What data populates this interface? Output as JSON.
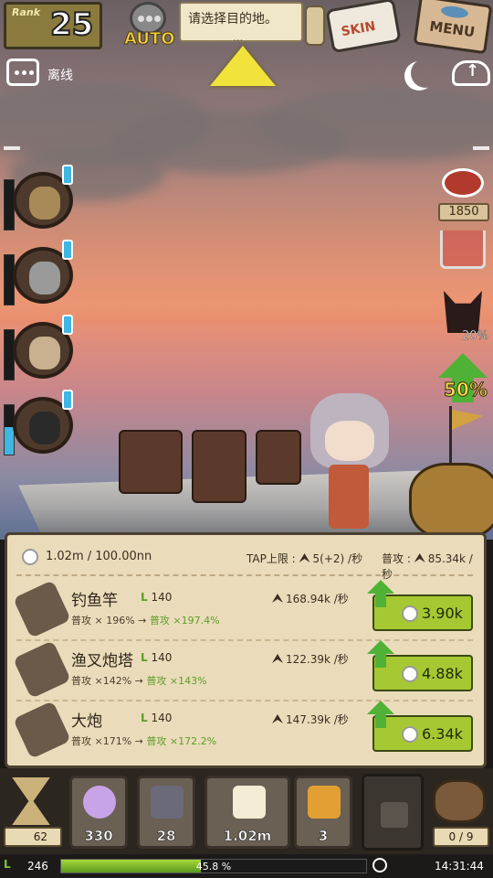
{
  "top": {
    "rank_label": "Rank",
    "rank_value": "25",
    "auto_label": "AUTO",
    "destination_text": "请选择目的地。",
    "destination_dots": "...",
    "skin_label": "SKIN",
    "menu_label": "MENU"
  },
  "status": {
    "chat_status": "离线"
  },
  "side": {
    "meat_count": "1850",
    "demon_percent": "20%",
    "boost_label": "50%"
  },
  "heroes": [
    {
      "name": "hero-1",
      "hp": 0.0,
      "color": "#a88a58"
    },
    {
      "name": "hero-2",
      "hp": 0.0,
      "color": "#9a9a9a"
    },
    {
      "name": "hero-3",
      "hp": 0.0,
      "color": "#c8b090"
    },
    {
      "name": "hero-4",
      "hp": 0.55,
      "color": "#2a2a2a"
    }
  ],
  "panel": {
    "resource": "1.02m / 100.00nn",
    "resource_main": "1.02m",
    "resource_max": "/ 100.00nn",
    "tap_label": "TAP上限 :",
    "tap_value": "5(+2) /秒",
    "attack_label": "普攻 :",
    "attack_value": "85.34k /秒"
  },
  "upgrades": [
    {
      "name": "钓鱼竿",
      "level": "140",
      "dps": "168.94k /秒",
      "current": "普攻 × 196%",
      "next": "普攻 ×197.4%",
      "cost": "3.90k"
    },
    {
      "name": "渔叉炮塔",
      "level": "140",
      "dps": "122.39k /秒",
      "current": "普攻 ×142%",
      "next": "普攻 ×143%",
      "cost": "4.88k"
    },
    {
      "name": "大炮",
      "level": "140",
      "dps": "147.39k /秒",
      "current": "普攻 ×171%",
      "next": "普攻 ×172.2%",
      "cost": "6.34k"
    }
  ],
  "bottom": {
    "hourglass_count": "62",
    "gems": [
      {
        "name": "orb",
        "value": "330",
        "color": "#c9a3e8"
      },
      {
        "name": "shield",
        "value": "28",
        "color": "#6a6a7a"
      },
      {
        "name": "coin",
        "value": "1.02m",
        "color": "#f4ecd4"
      },
      {
        "name": "amber",
        "value": "3",
        "color": "#e2a034"
      }
    ],
    "bag_count": "0 / 9",
    "level": "246",
    "xp_percent": "45.8 %",
    "xp_fraction": 0.458,
    "time": "14:31:44"
  },
  "colors": {
    "accent_green": "#a6c832",
    "panel": "#eadcba",
    "target_yellow": "#f1e33c"
  }
}
